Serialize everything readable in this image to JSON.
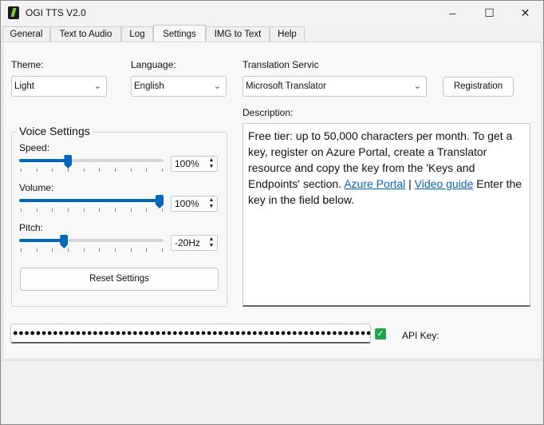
{
  "window": {
    "title": "OGI TTS V2.0",
    "icons": {
      "minimize": "minimize-icon",
      "maximize": "maximize-icon",
      "close": "close-icon",
      "app": "app-logo-icon"
    }
  },
  "tabs": [
    {
      "label": "General"
    },
    {
      "label": "Text to Audio"
    },
    {
      "label": "Log"
    },
    {
      "label": "Settings",
      "active": true
    },
    {
      "label": "IMG to Text"
    },
    {
      "label": "Help"
    }
  ],
  "settings": {
    "theme_label": "Theme:",
    "theme_value": "Light",
    "language_label": "Language:",
    "language_value": "English",
    "translation_label": "Translation Servic",
    "translation_value": "Microsoft Translator",
    "registration_button": "Registration",
    "description_label": "Description:",
    "description": {
      "text_before": "Free tier: up to 50,000 characters per month. To get a key, register on Azure Portal, create a Translator resource and copy the key from the 'Keys and Endpoints' section. ",
      "link1": "Azure Portal",
      "separator": " | ",
      "link2": "Video guide",
      "text_after": " Enter the key in the field below."
    }
  },
  "voice": {
    "title": "Voice Settings",
    "speed_label": "Speed:",
    "speed_value": "100%",
    "speed_level": 0.33,
    "volume_label": "Volume:",
    "volume_value": "100%",
    "volume_level": 1.0,
    "pitch_label": "Pitch:",
    "pitch_value": "-20Hz",
    "pitch_level": 0.3,
    "reset_button": "Reset Settings"
  },
  "api": {
    "masked_value": "●●●●●●●●●●●●●●●●●●●●●●●●●●●●●●●●●●●●●●●●●●●●●●●●●●●●●●●●●●●●●●●●●●●●●●●●●●●",
    "show_checked": true,
    "label": "API Key:"
  },
  "colors": {
    "accent": "#0067c0",
    "checkbox": "#1fa64d",
    "link": "#0563c1"
  }
}
